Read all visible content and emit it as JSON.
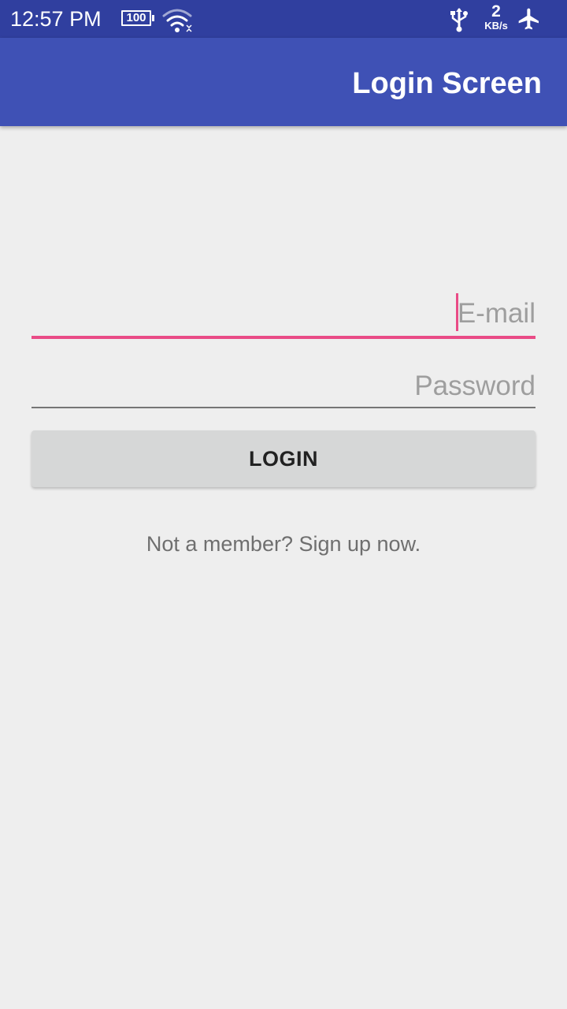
{
  "status_bar": {
    "time": "12:57 PM",
    "battery_level": "100",
    "net_speed_value": "2",
    "net_speed_unit": "KB/s",
    "icons": [
      "battery-icon",
      "wifi-icon",
      "usb-icon",
      "airplane-mode-icon"
    ]
  },
  "app_bar": {
    "title": "Login Screen"
  },
  "form": {
    "email_placeholder": "E-mail",
    "email_value": "",
    "password_placeholder": "Password",
    "password_value": "",
    "login_label": "LOGIN",
    "signup_text": "Not a member? Sign up now."
  },
  "colors": {
    "status_bar": "#303f9f",
    "app_bar": "#3f51b5",
    "accent": "#e94b86",
    "background": "#eeeeee",
    "button": "#d6d7d7"
  }
}
